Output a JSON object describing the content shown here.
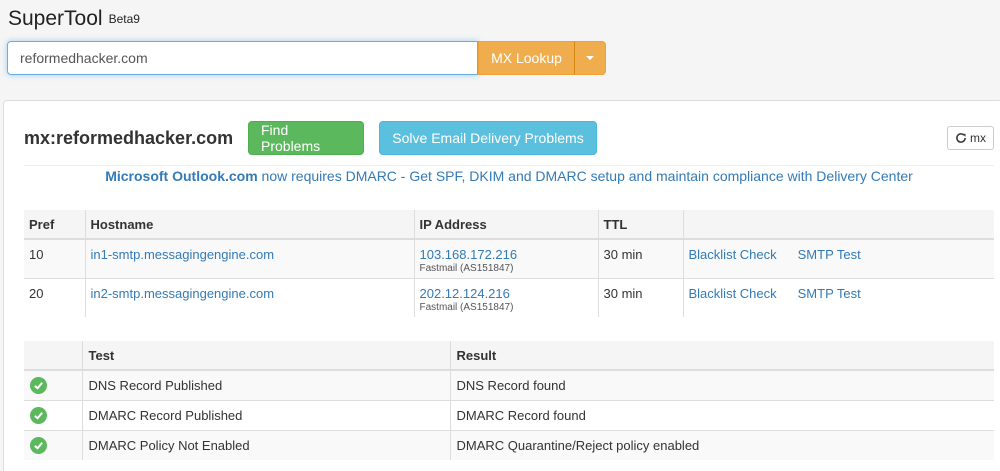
{
  "app": {
    "title": "SuperTool",
    "version": "Beta9"
  },
  "search": {
    "value": "reformedhacker.com",
    "lookup_label": "MX Lookup"
  },
  "panel": {
    "title": "mx:reformedhacker.com",
    "find_problems_label": "Find Problems",
    "solve_label": "Solve Email Delivery Problems",
    "refresh_label": "mx"
  },
  "promo": {
    "link_text": "Microsoft Outlook.com",
    "text": " now requires DMARC - Get SPF, DKIM and DMARC setup and maintain compliance with Delivery Center"
  },
  "mx_table": {
    "headers": [
      "Pref",
      "Hostname",
      "IP Address",
      "TTL",
      ""
    ],
    "rows": [
      {
        "pref": "10",
        "hostname": "in1-smtp.messagingengine.com",
        "ip": "103.168.172.216",
        "asn": "Fastmail (AS151847)",
        "ttl": "30 min",
        "blacklist": "Blacklist Check",
        "smtp": "SMTP Test"
      },
      {
        "pref": "20",
        "hostname": "in2-smtp.messagingengine.com",
        "ip": "202.12.124.216",
        "asn": "Fastmail (AS151847)",
        "ttl": "30 min",
        "blacklist": "Blacklist Check",
        "smtp": "SMTP Test"
      }
    ]
  },
  "test_table": {
    "headers": [
      "",
      "Test",
      "Result"
    ],
    "rows": [
      {
        "status_icon": "check-circle-icon",
        "test": "DNS Record Published",
        "result": "DNS Record found"
      },
      {
        "status_icon": "check-circle-icon",
        "test": "DMARC Record Published",
        "result": "DMARC Record found"
      },
      {
        "status_icon": "check-circle-icon",
        "test": "DMARC Policy Not Enabled",
        "result": "DMARC Quarantine/Reject policy enabled"
      }
    ]
  },
  "colors": {
    "lookup_button": "#f0ad4e",
    "find_problems_button": "#5cb85c",
    "solve_button": "#5bc0de",
    "link": "#337ab7",
    "status_ok": "#5cb85c"
  }
}
